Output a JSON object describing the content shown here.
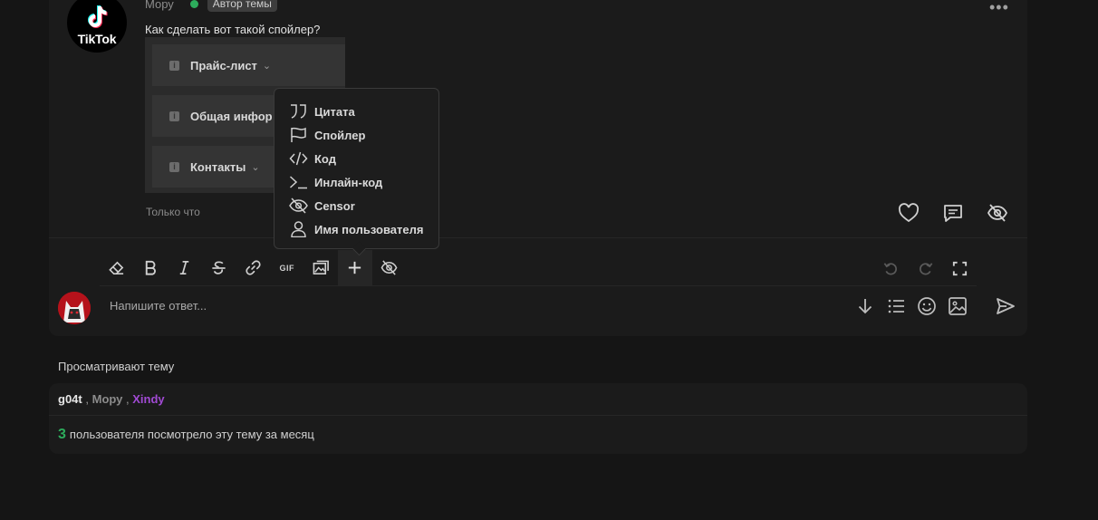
{
  "post": {
    "author": "Мору",
    "author_badge": "Автор темы",
    "avatar_brand": "TikTok",
    "text": "Как сделать вот такой спойлер?",
    "spoilers": [
      {
        "label": "Прайс-лист"
      },
      {
        "label": "Общая инфор"
      },
      {
        "label": "Контакты"
      }
    ],
    "time": "Только что",
    "more": "•••"
  },
  "insert_menu": {
    "items": [
      {
        "label": "Цитата",
        "icon": "quote-icon"
      },
      {
        "label": "Спойлер",
        "icon": "flag-icon"
      },
      {
        "label": "Код",
        "icon": "code-icon"
      },
      {
        "label": "Инлайн-код",
        "icon": "terminal-icon"
      },
      {
        "label": "Censor",
        "icon": "eye-off-icon"
      },
      {
        "label": "Имя пользователя",
        "icon": "user-icon"
      }
    ]
  },
  "editor": {
    "toolbar": [
      "eraser-icon",
      "bold-icon",
      "italic-icon",
      "strikethrough-icon",
      "link-icon",
      "gif-icon",
      "image-gallery-icon",
      "plus-icon",
      "eye-off-icon"
    ],
    "gif_label": "GIF",
    "reply_placeholder": "Напишите ответ..."
  },
  "viewers": {
    "title": "Просматривают тему",
    "users": [
      "g04t",
      "Мору",
      "Xindy"
    ],
    "separator": ",",
    "monthly_count": "3",
    "monthly_text": "пользователя посмотрело эту тему за месяц"
  },
  "colors": {
    "background": "#151515",
    "card": "#1b1b1b",
    "online": "#2dac5c",
    "accent_user": "#a14ad4"
  }
}
